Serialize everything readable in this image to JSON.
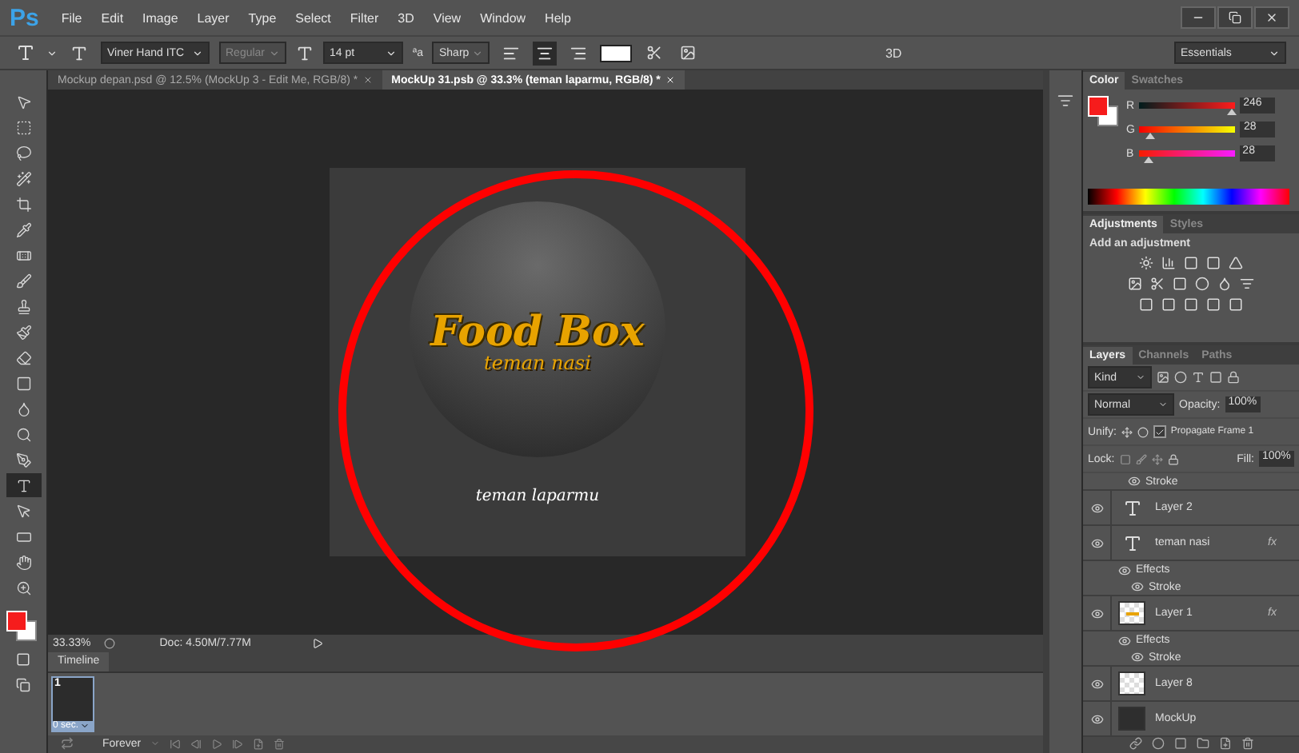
{
  "menu": {
    "logo": "Ps",
    "items": [
      "File",
      "Edit",
      "Image",
      "Layer",
      "Type",
      "Select",
      "Filter",
      "3D",
      "View",
      "Window",
      "Help"
    ]
  },
  "options_bar": {
    "font_family": "Viner Hand ITC",
    "font_style": "Regular",
    "font_size": "14 pt",
    "antialias_label": "ªa",
    "antialias": "Sharp",
    "alignment": [
      {
        "selected": false
      },
      {
        "selected": true
      },
      {
        "selected": false
      }
    ],
    "mode": "3D",
    "workspace": "Essentials"
  },
  "tabs": [
    {
      "label": "Mockup depan.psd @ 12.5% (MockUp 3 - Edit Me, RGB/8) *",
      "selected": false
    },
    {
      "label": "MockUp 31.psb @ 33.3% (teman laparmu, RGB/8) *",
      "selected": true
    }
  ],
  "tools": [
    {
      "selected": false
    },
    {
      "selected": false
    },
    {
      "selected": false
    },
    {
      "selected": false
    },
    {
      "selected": false
    },
    {
      "selected": false
    },
    {
      "selected": false
    },
    {
      "selected": false
    },
    {
      "selected": false
    },
    {
      "selected": false
    },
    {
      "selected": false
    },
    {
      "selected": false
    },
    {
      "selected": false
    },
    {
      "selected": false
    },
    {
      "selected": false
    },
    {
      "selected": true
    },
    {
      "selected": false
    },
    {
      "selected": false
    },
    {
      "selected": false
    },
    {
      "selected": false
    }
  ],
  "document": {
    "title": "Food Box",
    "subtitle": "teman nasi",
    "tagline": "teman laparmu"
  },
  "status_bar": {
    "zoom": "33.33%",
    "doc_size": "Doc: 4.50M/7.77M"
  },
  "timeline": {
    "title": "Timeline",
    "frames": [
      {
        "number": "1",
        "delay": "0 sec.",
        "selected": true
      }
    ],
    "loop": "Forever"
  },
  "color_panel": {
    "tabs": [
      {
        "label": "Color",
        "selected": true
      },
      {
        "label": "Swatches",
        "selected": false
      }
    ],
    "channels": [
      {
        "name": "R",
        "value": "246",
        "level": 0.96
      },
      {
        "name": "G",
        "value": "28",
        "level": 0.11
      },
      {
        "name": "B",
        "value": "28",
        "level": 0.11
      }
    ]
  },
  "adjustments_panel": {
    "tabs": [
      {
        "label": "Adjustments",
        "selected": true
      },
      {
        "label": "Styles",
        "selected": false
      }
    ],
    "heading": "Add an adjustment"
  },
  "layers_panel": {
    "tabs": [
      {
        "label": "Layers",
        "selected": true
      },
      {
        "label": "Channels",
        "selected": false
      },
      {
        "label": "Paths",
        "selected": false
      }
    ],
    "filter": "Kind",
    "blend_mode": "Normal",
    "opacity_label": "Opacity:",
    "opacity": "100%",
    "unify_label": "Unify:",
    "propagate": {
      "label": "Propagate Frame 1",
      "checked": true
    },
    "lock_label": "Lock:",
    "fill_label": "Fill:",
    "fill": "100%",
    "layers": [
      {
        "kind": "effect",
        "name": "Stroke",
        "visible": true
      },
      {
        "kind": "text",
        "name": "Layer 2",
        "visible": true
      },
      {
        "kind": "text",
        "name": "teman nasi",
        "visible": true,
        "badge": "fx",
        "children": [
          {
            "kind": "effects",
            "name": "Effects",
            "visible": true,
            "children": [
              {
                "kind": "effect",
                "name": "Stroke",
                "visible": true
              }
            ]
          }
        ]
      },
      {
        "kind": "art",
        "name": "Layer 1",
        "visible": true,
        "badge": "fx",
        "children": [
          {
            "kind": "effects",
            "name": "Effects",
            "visible": true,
            "children": [
              {
                "kind": "effect",
                "name": "Stroke",
                "visible": true
              }
            ]
          }
        ]
      },
      {
        "kind": "empty",
        "name": "Layer 8",
        "visible": true
      },
      {
        "kind": "fill",
        "name": "MockUp",
        "visible": true
      }
    ]
  }
}
